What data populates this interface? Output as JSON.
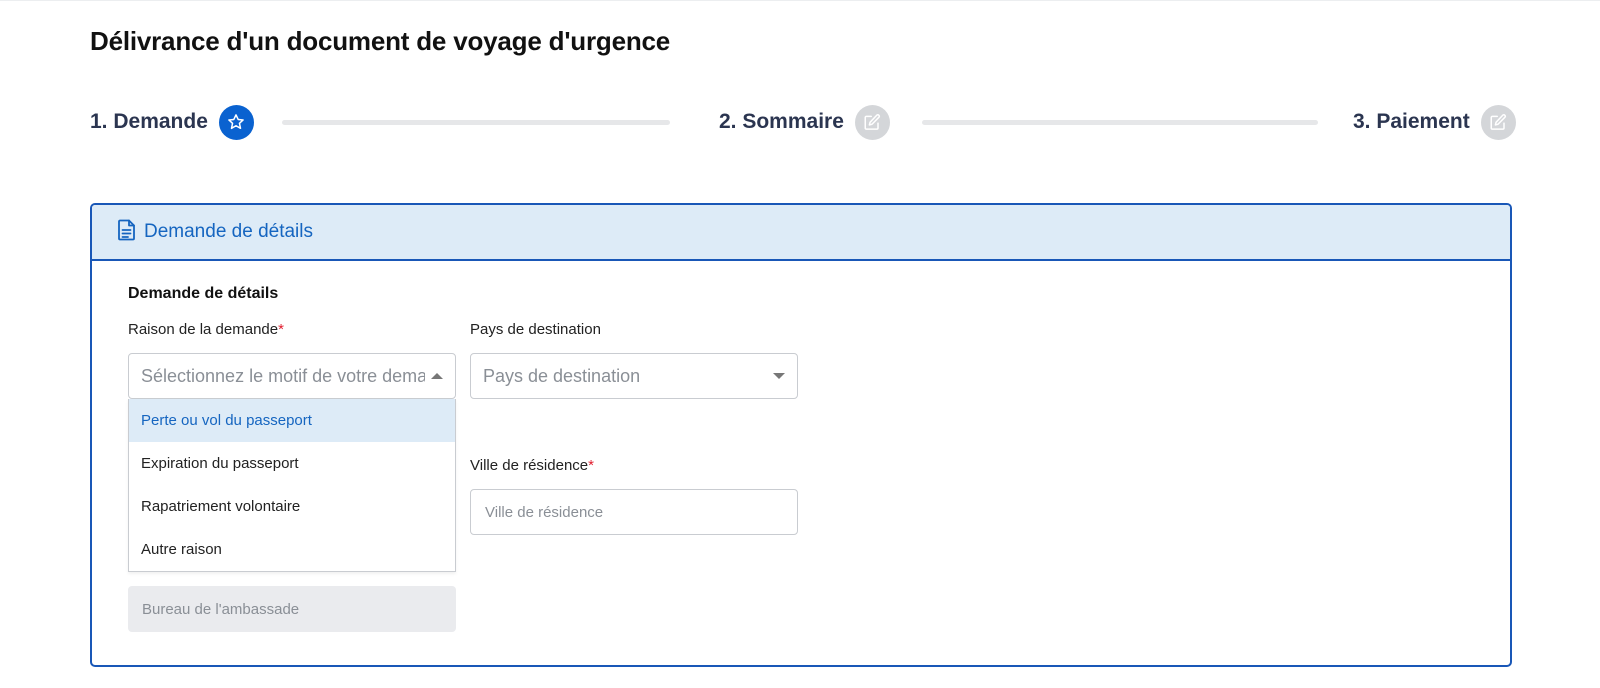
{
  "page": {
    "title": "Délivrance d'un document de voyage d'urgence"
  },
  "stepper": {
    "steps": [
      {
        "label": "1. Demande",
        "state": "active",
        "icon": "star-icon"
      },
      {
        "label": "2. Sommaire",
        "state": "inactive",
        "icon": "edit-icon"
      },
      {
        "label": "3. Paiement",
        "state": "inactive",
        "icon": "edit-icon"
      }
    ]
  },
  "card": {
    "header_title": "Demande de détails",
    "header_icon": "document-icon",
    "section_title": "Demande de détails"
  },
  "form": {
    "reason": {
      "label": "Raison de la demande",
      "required_mark": "*",
      "placeholder": "Sélectionnez le motif de votre demande",
      "options": [
        "Perte ou vol du passeport",
        "Expiration du passeport",
        "Rapatriement volontaire",
        "Autre raison"
      ],
      "highlighted_index": 0
    },
    "destination": {
      "label": "Pays de destination",
      "placeholder": "Pays de destination"
    },
    "residence_city": {
      "label": "Ville de résidence",
      "required_mark": "*",
      "placeholder": "Ville de résidence"
    },
    "embassy_office": {
      "placeholder": "Bureau de l'ambassade"
    }
  },
  "colors": {
    "primary": "#1957b7",
    "active_step": "#0a62d0",
    "inactive_step": "#d4d6d9",
    "header_bg": "#ddebf7",
    "required": "#e11d2e"
  }
}
